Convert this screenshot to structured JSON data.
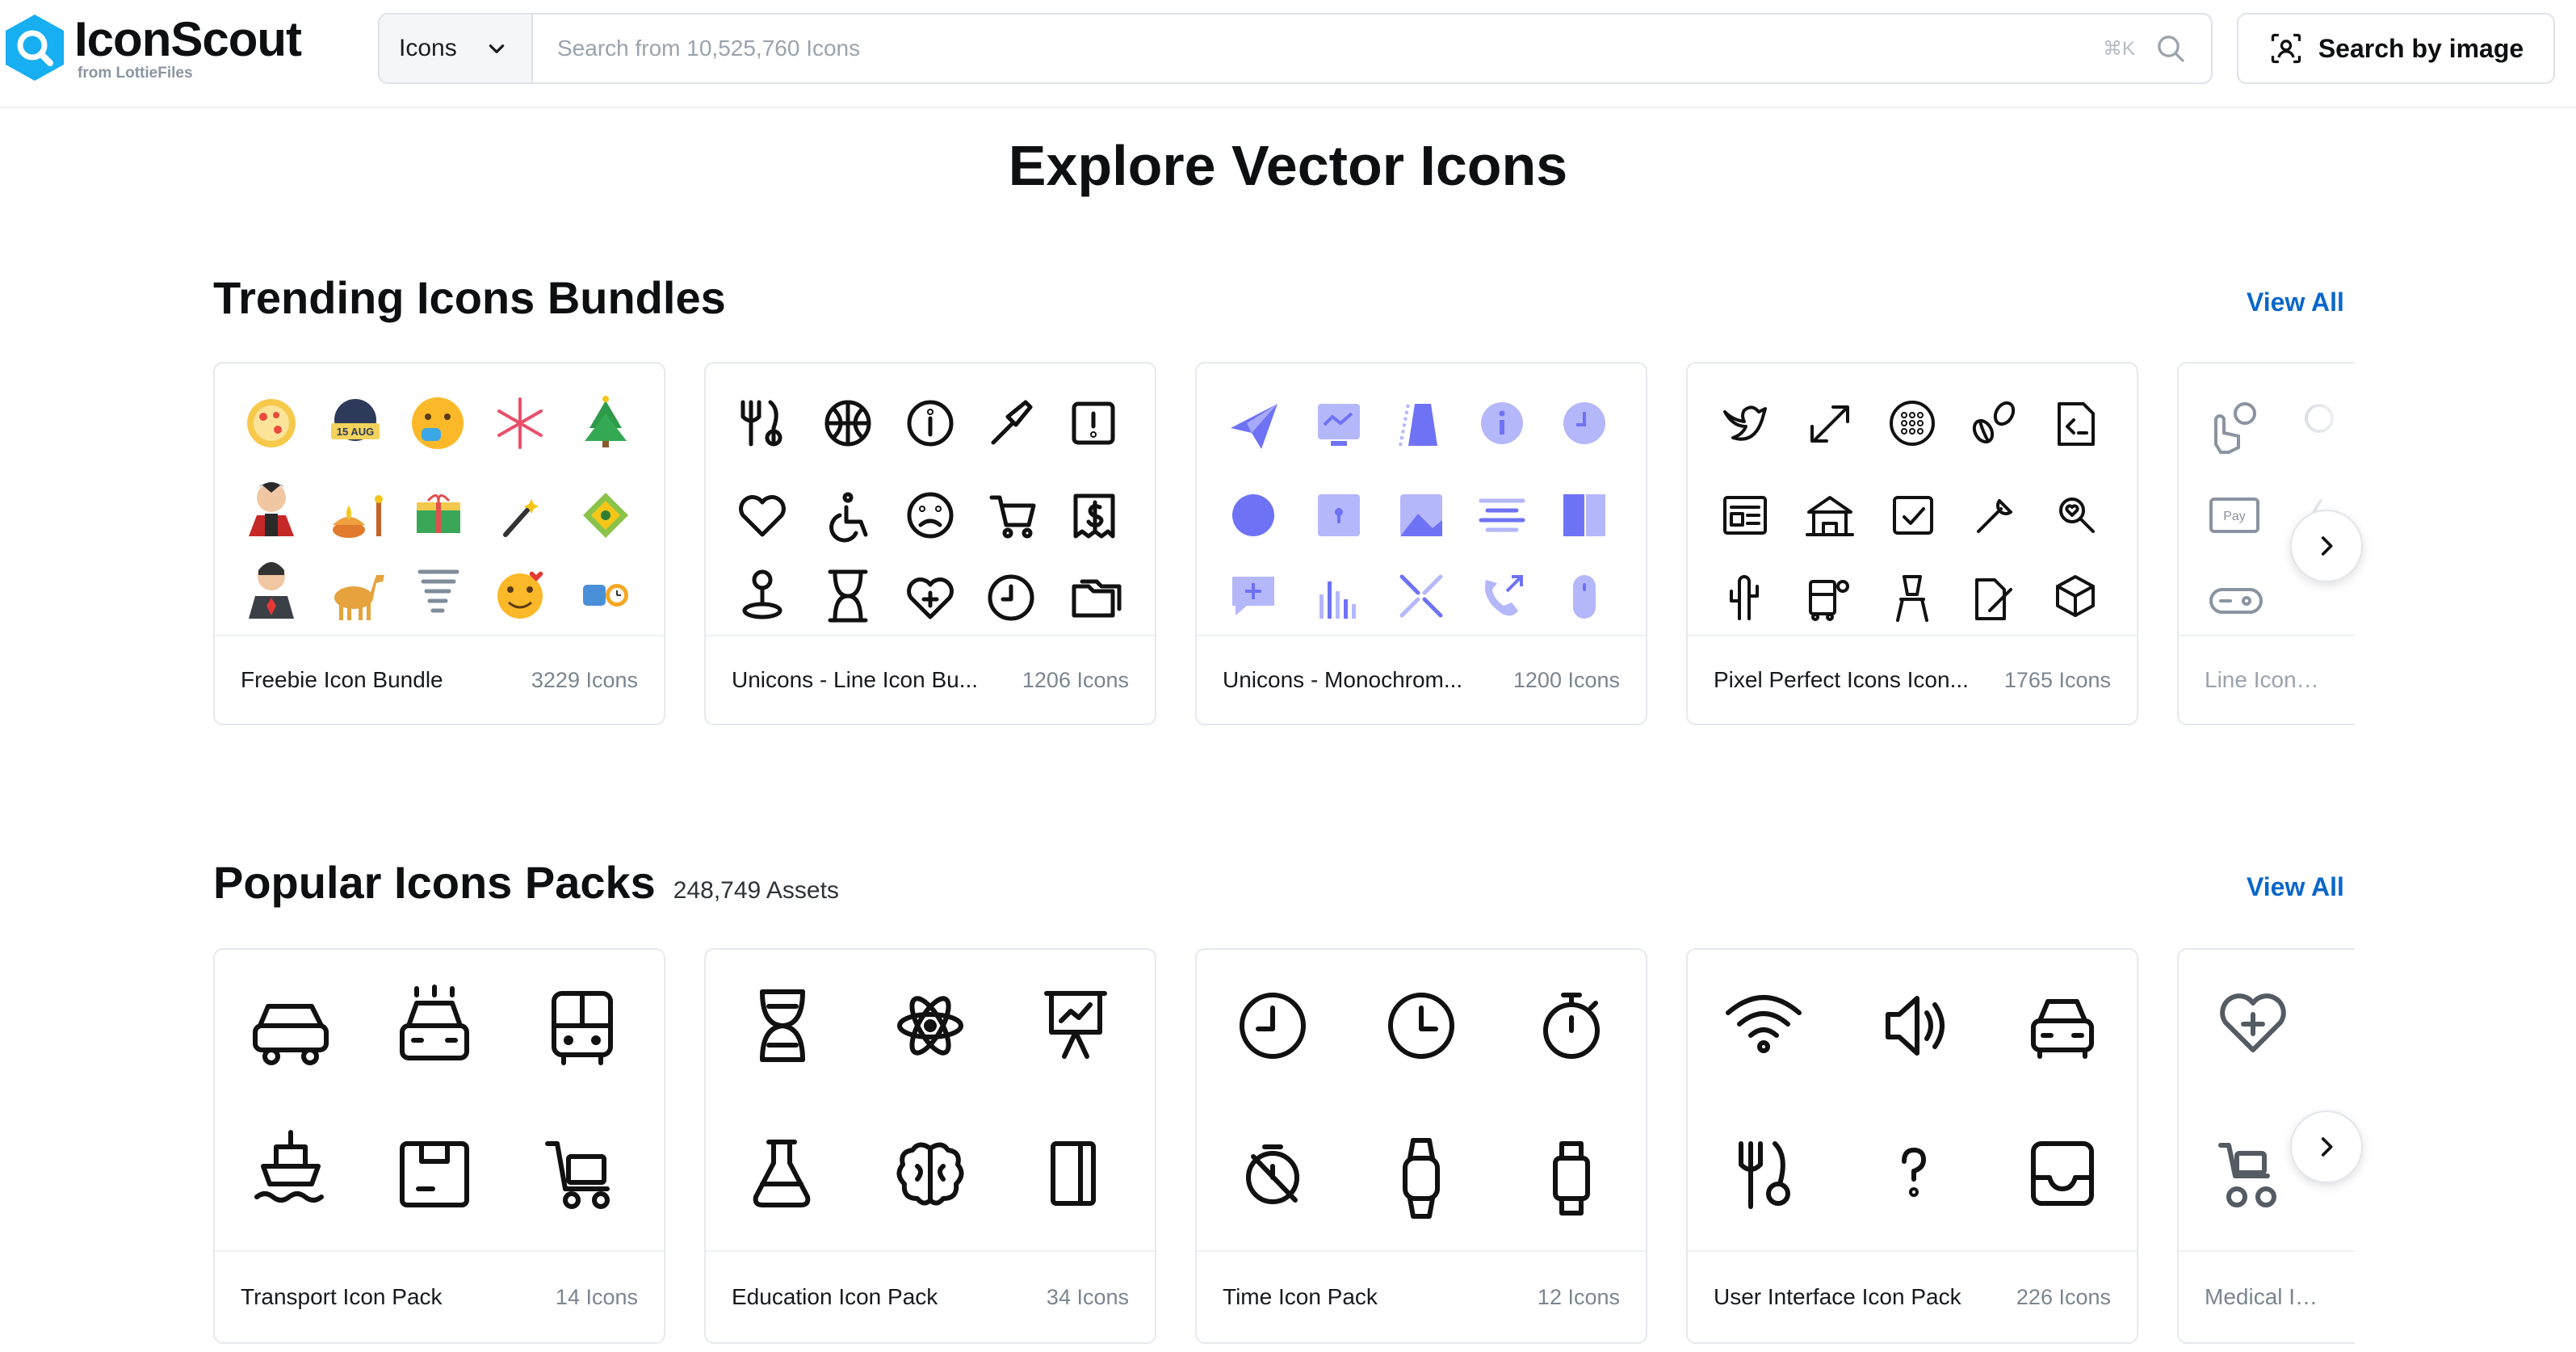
{
  "header": {
    "logo_name": "IconScout",
    "logo_sub": "from LottieFiles",
    "search_type": "Icons",
    "search_placeholder": "Search from 10,525,760 Icons",
    "shortcut": "⌘K",
    "image_search_label": "Search by image"
  },
  "page_title": "Explore Vector Icons",
  "trending": {
    "title": "Trending Icons Bundles",
    "view_all": "View All",
    "cards": [
      {
        "name": "Freebie Icon Bundle",
        "count": "3229 Icons"
      },
      {
        "name": "Unicons - Line Icon Bu...",
        "count": "1206 Icons"
      },
      {
        "name": "Unicons - Monochrom...",
        "count": "1200 Icons"
      },
      {
        "name": "Pixel Perfect Icons Icon...",
        "count": "1765 Icons"
      },
      {
        "name": "Line Icons Ic",
        "count": ""
      }
    ]
  },
  "popular": {
    "title": "Popular Icons Packs",
    "count": "248,749 Assets",
    "view_all": "View All",
    "cards": [
      {
        "name": "Transport Icon Pack",
        "count": "14 Icons"
      },
      {
        "name": "Education Icon Pack",
        "count": "34 Icons"
      },
      {
        "name": "Time Icon Pack",
        "count": "12 Icons"
      },
      {
        "name": "User Interface Icon Pack",
        "count": "226 Icons"
      },
      {
        "name": "Medical Icon",
        "count": ""
      }
    ]
  },
  "colors": {
    "accent": "#0a67c9",
    "logo_blue": "#16a8f0",
    "mono_purple": "#7b7ef7"
  }
}
